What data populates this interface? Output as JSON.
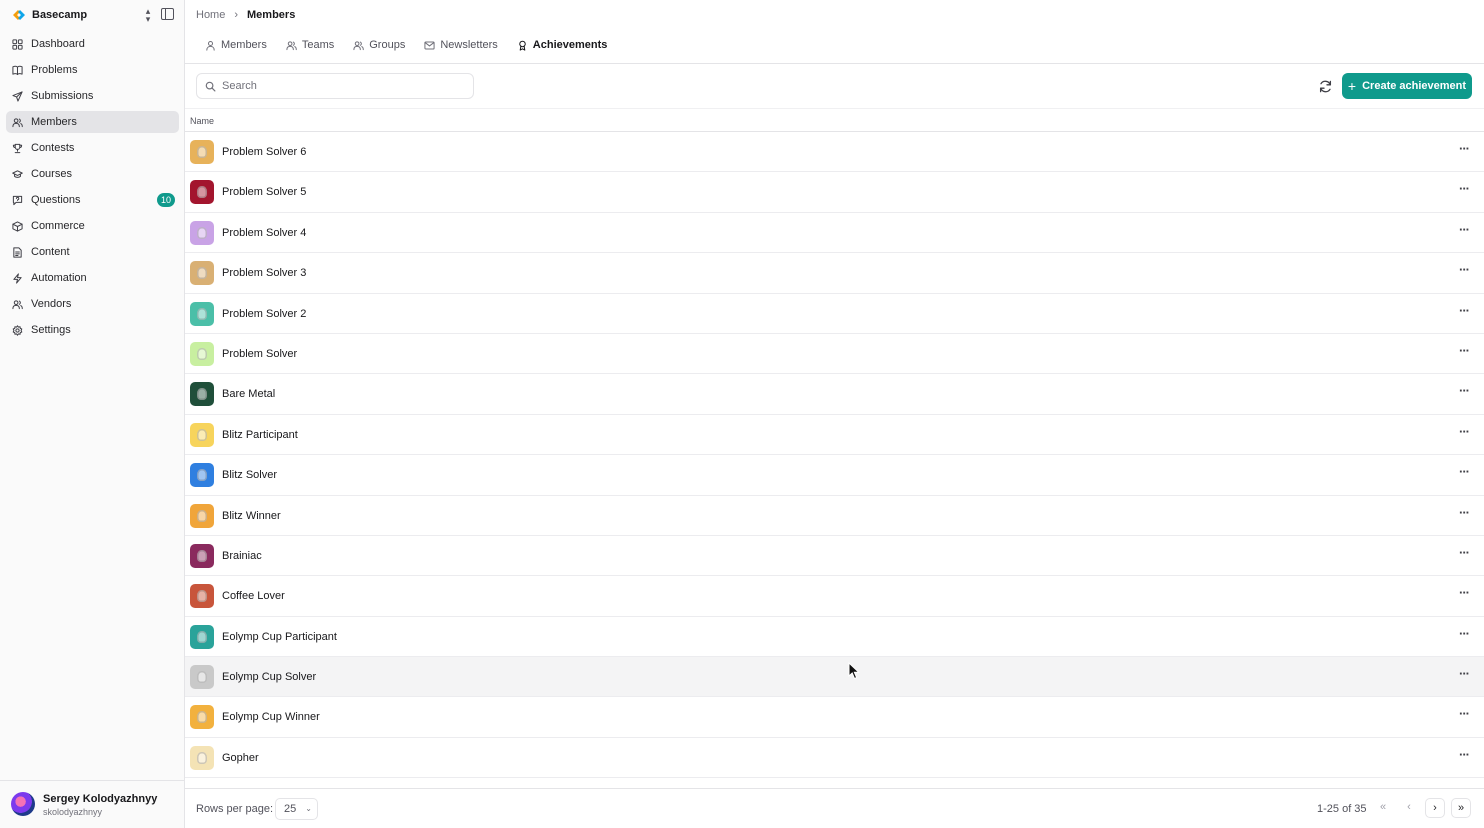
{
  "app": {
    "name": "Basecamp"
  },
  "sidebar": {
    "items": [
      {
        "label": "Dashboard",
        "icon": "dashboard-icon"
      },
      {
        "label": "Problems",
        "icon": "book-icon"
      },
      {
        "label": "Submissions",
        "icon": "send-icon"
      },
      {
        "label": "Members",
        "icon": "users-icon",
        "active": true
      },
      {
        "label": "Contests",
        "icon": "trophy-icon"
      },
      {
        "label": "Courses",
        "icon": "graduation-cap-icon"
      },
      {
        "label": "Questions",
        "icon": "message-question-icon",
        "badge": "10"
      },
      {
        "label": "Commerce",
        "icon": "package-icon"
      },
      {
        "label": "Content",
        "icon": "file-text-icon"
      },
      {
        "label": "Automation",
        "icon": "zap-icon"
      },
      {
        "label": "Vendors",
        "icon": "users-icon"
      },
      {
        "label": "Settings",
        "icon": "gear-icon"
      }
    ]
  },
  "user": {
    "name": "Sergey Kolodyazhnyy",
    "handle": "skolodyazhnyy"
  },
  "breadcrumb": {
    "home": "Home",
    "current": "Members"
  },
  "tabs": [
    {
      "label": "Members",
      "icon": "user-icon"
    },
    {
      "label": "Teams",
      "icon": "users-icon"
    },
    {
      "label": "Groups",
      "icon": "users-icon"
    },
    {
      "label": "Newsletters",
      "icon": "mail-icon"
    },
    {
      "label": "Achievements",
      "icon": "award-icon",
      "active": true
    }
  ],
  "search": {
    "placeholder": "Search",
    "value": ""
  },
  "toolbar": {
    "create_label": "Create achievement",
    "create_icon": "plus-icon",
    "refresh_icon": "refresh-icon"
  },
  "table": {
    "column_name": "Name",
    "rows": [
      {
        "name": "Problem Solver 6",
        "color": "#e7b25a"
      },
      {
        "name": "Problem Solver 5",
        "color": "#a3152e"
      },
      {
        "name": "Problem Solver 4",
        "color": "#c9a3e6"
      },
      {
        "name": "Problem Solver 3",
        "color": "#d9b074"
      },
      {
        "name": "Problem Solver 2",
        "color": "#4bbfa8"
      },
      {
        "name": "Problem Solver",
        "color": "#c8efa0"
      },
      {
        "name": "Bare Metal",
        "color": "#1f4f3a"
      },
      {
        "name": "Blitz Participant",
        "color": "#f7d45c"
      },
      {
        "name": "Blitz Solver",
        "color": "#2f7fe0"
      },
      {
        "name": "Blitz Winner",
        "color": "#f0a53a"
      },
      {
        "name": "Brainiac",
        "color": "#8a2a5e"
      },
      {
        "name": "Coffee Lover",
        "color": "#c8553b"
      },
      {
        "name": "Eolymp Cup Participant",
        "color": "#2aa39a"
      },
      {
        "name": "Eolymp Cup Solver",
        "color": "#c9c9c9"
      },
      {
        "name": "Eolymp Cup Winner",
        "color": "#f2b13e"
      },
      {
        "name": "Gopher",
        "color": "#f4e3b5"
      }
    ],
    "hover_row_index": 13
  },
  "footer": {
    "rows_per_page_label": "Rows per page:",
    "rows_per_page_value": "25",
    "range": "1-25 of 35",
    "first": "«",
    "prev": "‹",
    "next": "›",
    "last": "»"
  },
  "colors": {
    "accent": "#0f9a8c",
    "active_nav_bg": "#e4e4e7"
  }
}
